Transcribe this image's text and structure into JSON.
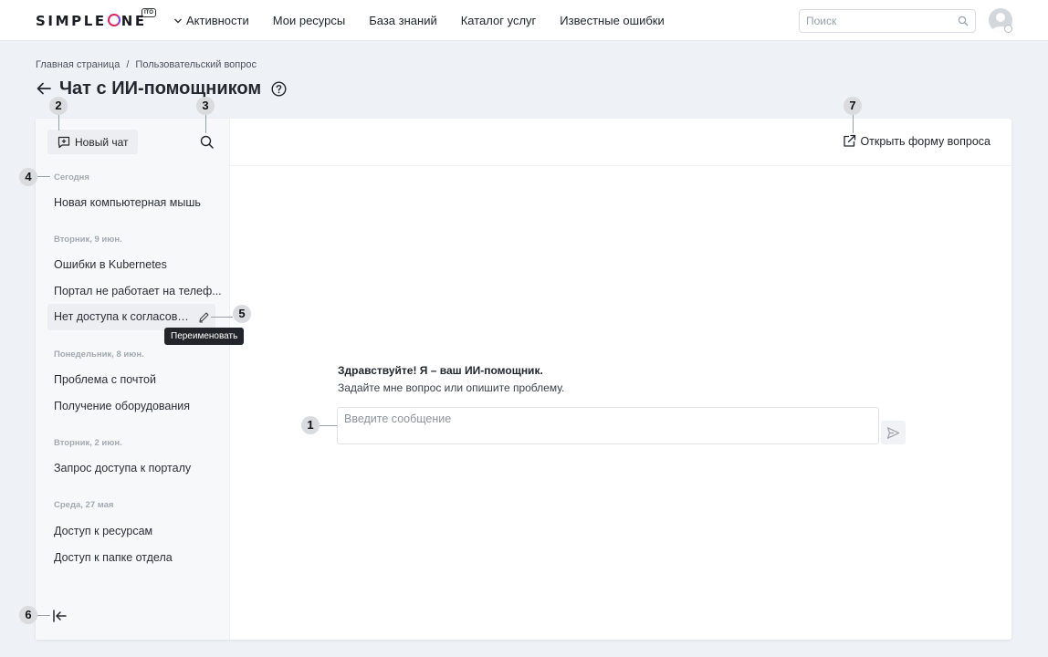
{
  "header": {
    "logo": "SIMPLEONE",
    "logo_badge": "ITO",
    "nav": [
      {
        "label": "Активности",
        "dropdown": true
      },
      {
        "label": "Мои ресурсы"
      },
      {
        "label": "База знаний"
      },
      {
        "label": "Каталог услуг"
      },
      {
        "label": "Известные ошибки"
      }
    ],
    "search_placeholder": "Поиск"
  },
  "breadcrumb": {
    "items": [
      "Главная страница",
      "Пользовательский вопрос"
    ],
    "separator": "/"
  },
  "page": {
    "title": "Чат с ИИ-помощником"
  },
  "sidebar": {
    "new_chat_label": "Новый чат",
    "groups": [
      {
        "title": "Сегодня",
        "items": [
          "Новая компьютерная мышь"
        ]
      },
      {
        "title": "Вторник, 9 июн.",
        "items": [
          "Ошибки в Kubernetes",
          "Портал не работает на телеф...",
          "Нет доступа к согласова..."
        ]
      },
      {
        "title": "Понедельник, 8 июн.",
        "items": [
          "Проблема с почтой",
          "Получение оборудования"
        ]
      },
      {
        "title": "Вторник, 2 июн.",
        "items": [
          "Запрос доступа к порталу"
        ]
      },
      {
        "title": "Среда, 27 мая",
        "items": [
          "Доступ к ресурсам",
          "Доступ к папке отдела"
        ]
      }
    ],
    "rename_tooltip": "Переименовать"
  },
  "content": {
    "open_form_label": "Открыть форму вопроса",
    "greeting_title": "Здравствуйте! Я – ваш ИИ-помощник.",
    "greeting_sub": "Задайте мне вопрос или опишите проблему.",
    "message_placeholder": "Введите сообщение"
  },
  "markers": [
    "1",
    "2",
    "3",
    "4",
    "5",
    "6",
    "7"
  ],
  "colors": {
    "accent": "#e0245e",
    "accent_2": "#7a3ff2",
    "background": "#eef1f5",
    "sidebar": "#f7f8fa",
    "tooltip": "#22262b"
  }
}
